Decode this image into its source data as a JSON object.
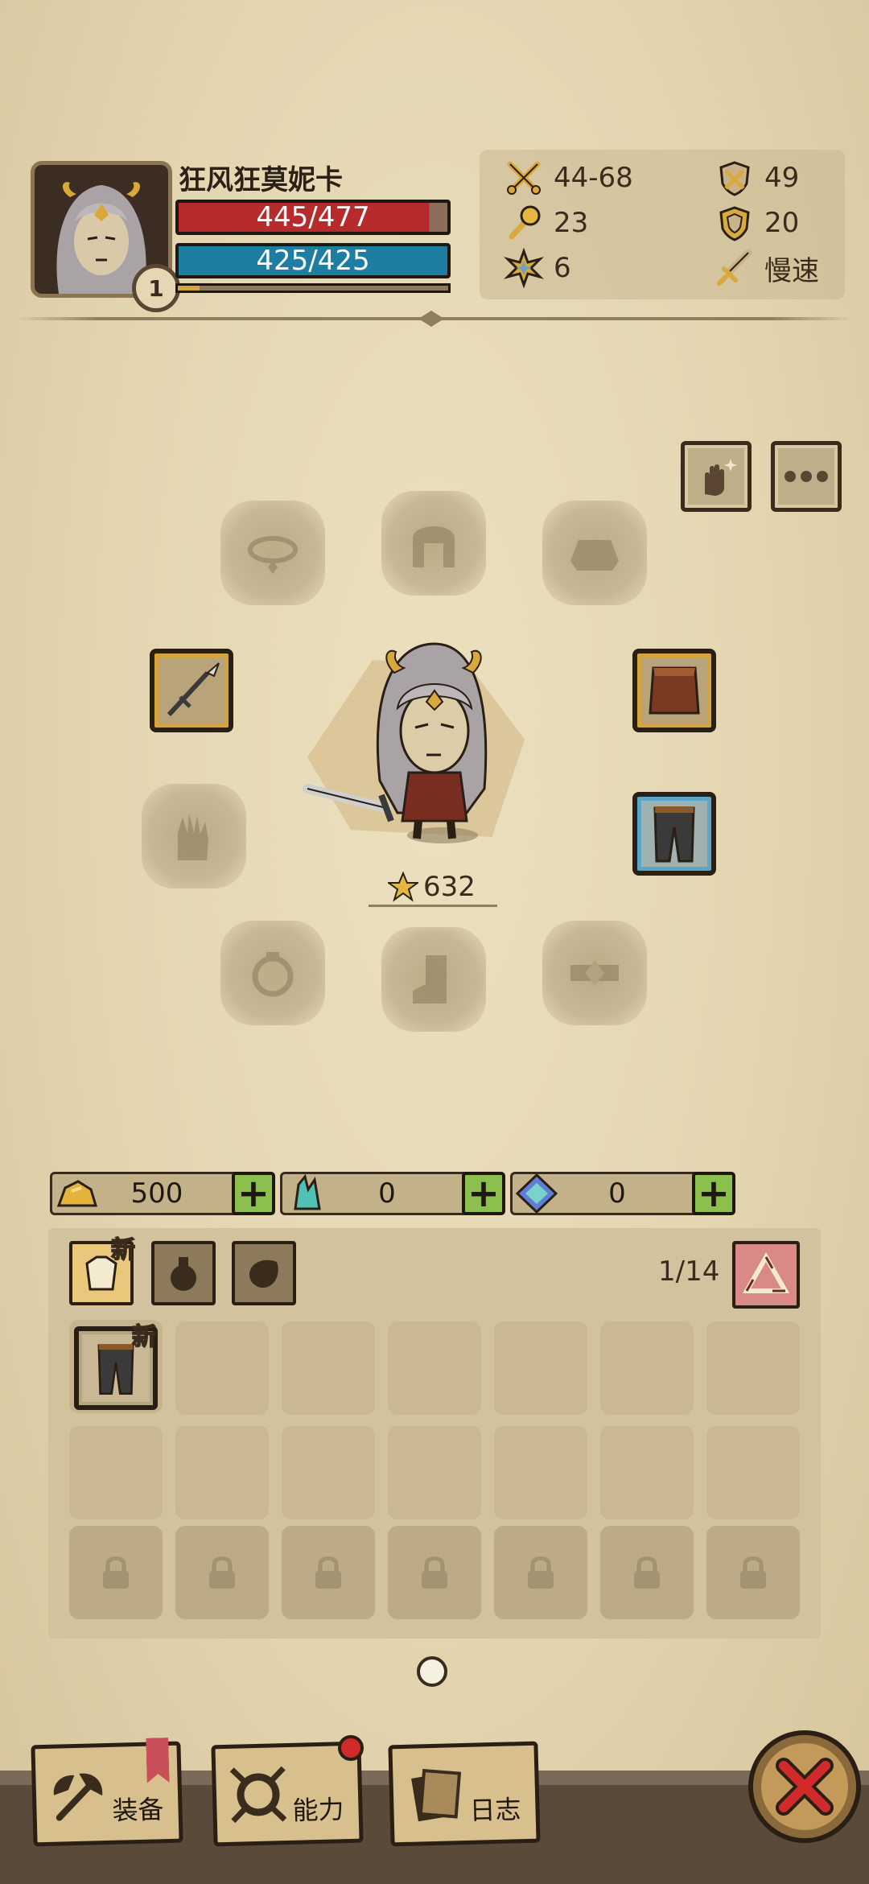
{
  "hero": {
    "name": "狂风狂莫妮卡",
    "level": "1",
    "hp_text": "445/477",
    "mp_text": "425/425",
    "hp_fraction": 0.933,
    "mp_fraction": 1.0,
    "xp_fraction": 0.08
  },
  "stats": {
    "attack": "44-68",
    "defense": "49",
    "magic": "23",
    "resist": "20",
    "crit": "6",
    "speed": "慢速"
  },
  "score": "632",
  "currency": [
    {
      "icon": "gold-ore-icon",
      "value": "500"
    },
    {
      "icon": "crystal-icon",
      "value": "0"
    },
    {
      "icon": "gem-icon",
      "value": "0"
    }
  ],
  "inventory": {
    "count": "1/14",
    "new_label": "新"
  },
  "nav": {
    "equip": "装备",
    "ability": "能力",
    "log": "日志"
  },
  "colors": {
    "hp": "#b72b2d",
    "mp": "#1e7ea1",
    "gold_frame": "#d7a53b",
    "blue_frame": "#5aa5c8",
    "plus": "#8cc04e",
    "close": "#d12a2a"
  }
}
